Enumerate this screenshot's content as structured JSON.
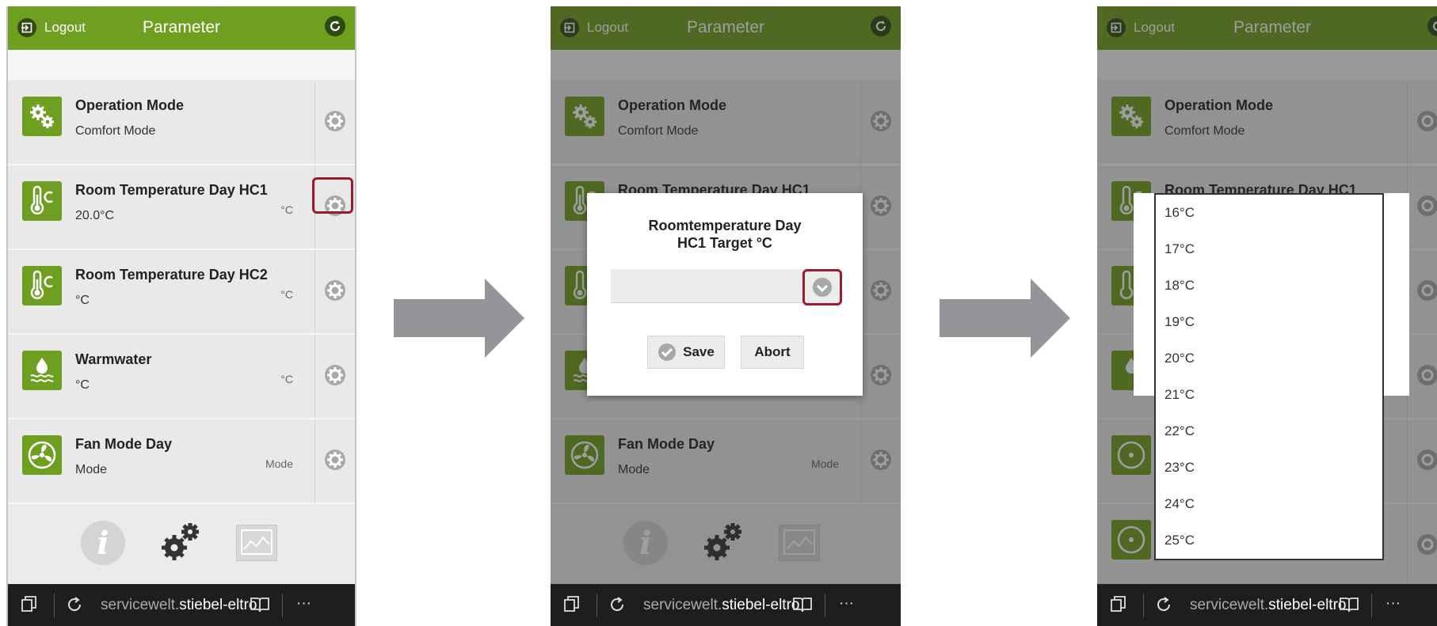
{
  "header": {
    "logout": "Logout",
    "title": "Parameter"
  },
  "items": [
    {
      "title": "Operation Mode",
      "value": "Comfort Mode",
      "unit": "",
      "icon": "gears-icon"
    },
    {
      "title": "Room Temperature Day HC1",
      "value": "20.0°C",
      "unit": "°C",
      "icon": "thermometer-icon"
    },
    {
      "title": "Room Temperature Day HC2",
      "value": "°C",
      "unit": "°C",
      "icon": "thermometer-icon"
    },
    {
      "title": "Warmwater",
      "value": "°C",
      "unit": "°C",
      "icon": "water-drop-icon"
    },
    {
      "title": "Fan Mode Day",
      "value": "Mode",
      "unit": "Mode",
      "icon": "fan-icon"
    }
  ],
  "nav": {
    "info_glyph": "i"
  },
  "browser": {
    "url_host": "servicewelt.",
    "url_domain": "stiebel-eltro",
    "more": "···"
  },
  "dialog": {
    "title_line1": "Roomtemperature Day",
    "title_line2": "HC1 Target °C",
    "save_label": "Save",
    "abort_label": "Abort"
  },
  "dropdown": {
    "options": [
      "16°C",
      "17°C",
      "18°C",
      "19°C",
      "20°C",
      "21°C",
      "22°C",
      "23°C",
      "24°C",
      "25°C"
    ]
  },
  "colors": {
    "brand_green": "#6f9f20",
    "highlight_red": "#9b1b30",
    "arrow_gray": "#939598"
  }
}
